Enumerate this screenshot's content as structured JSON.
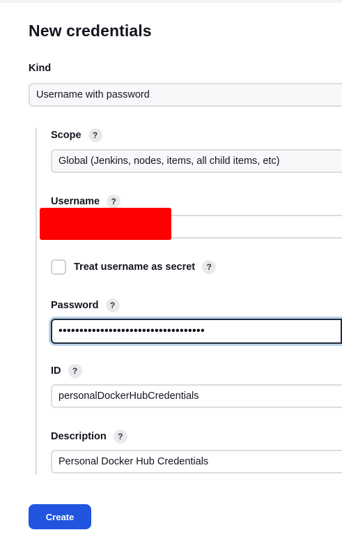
{
  "page": {
    "title": "New credentials"
  },
  "kind": {
    "label": "Kind",
    "value": "Username with password"
  },
  "scope": {
    "label": "Scope",
    "help": "?",
    "value": "Global (Jenkins, nodes, items, all child items, etc)"
  },
  "username": {
    "label": "Username",
    "help": "?",
    "value": ""
  },
  "treat_secret": {
    "label": "Treat username as secret",
    "help": "?",
    "checked": false
  },
  "password": {
    "label": "Password",
    "help": "?",
    "value": "•••••••••••••••••••••••••••••••••••"
  },
  "id": {
    "label": "ID",
    "help": "?",
    "value": "personalDockerHubCredentials"
  },
  "description": {
    "label": "Description",
    "help": "?",
    "value": "Personal Docker Hub Credentials"
  },
  "actions": {
    "create_label": "Create"
  },
  "colors": {
    "primary": "#2155e0",
    "redaction": "#ff0000",
    "focus_ring": "#bcd3ea"
  }
}
